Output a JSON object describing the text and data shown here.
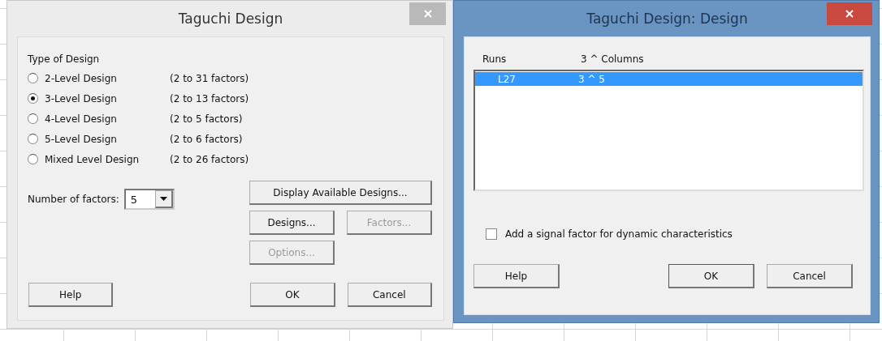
{
  "main_dialog": {
    "title": "Taguchi Design",
    "type_of_design": {
      "label": "Type of Design",
      "options": [
        {
          "label": "2-Level Design",
          "range": "(2 to 31 factors)",
          "selected": false
        },
        {
          "label": "3-Level Design",
          "range": "(2 to 13 factors)",
          "selected": true
        },
        {
          "label": "4-Level Design",
          "range": "(2 to 5 factors)",
          "selected": false
        },
        {
          "label": "5-Level Design",
          "range": "(2 to 6 factors)",
          "selected": false
        },
        {
          "label": "Mixed Level Design",
          "range": "(2 to 26 factors)",
          "selected": false
        }
      ]
    },
    "number_of_factors": {
      "label": "Number of factors:",
      "value": "5"
    },
    "buttons": [
      {
        "label": "Display Available Designs...",
        "disabled": false
      },
      {
        "label": "Designs...",
        "disabled": false
      },
      {
        "label": "Factors...",
        "disabled": true
      },
      {
        "label": "Options...",
        "disabled": true
      }
    ],
    "footer_buttons": [
      {
        "label": "Help",
        "disabled": false
      },
      {
        "label": "OK",
        "disabled": false
      },
      {
        "label": "Cancel",
        "disabled": false
      }
    ]
  },
  "design_dialog": {
    "title": "Taguchi Design: Design",
    "columns": [
      "Runs",
      "3 ^ Columns"
    ],
    "rows": [
      {
        "cells": [
          "L27",
          "3 ^  5"
        ],
        "selected": true
      }
    ],
    "signal_factor": {
      "label": "Add a signal factor for dynamic characteristics",
      "checked": false
    },
    "footer_buttons": [
      {
        "label": "Help",
        "default": false
      },
      {
        "label": "OK",
        "default": true
      },
      {
        "label": "Cancel",
        "default": false
      }
    ]
  }
}
